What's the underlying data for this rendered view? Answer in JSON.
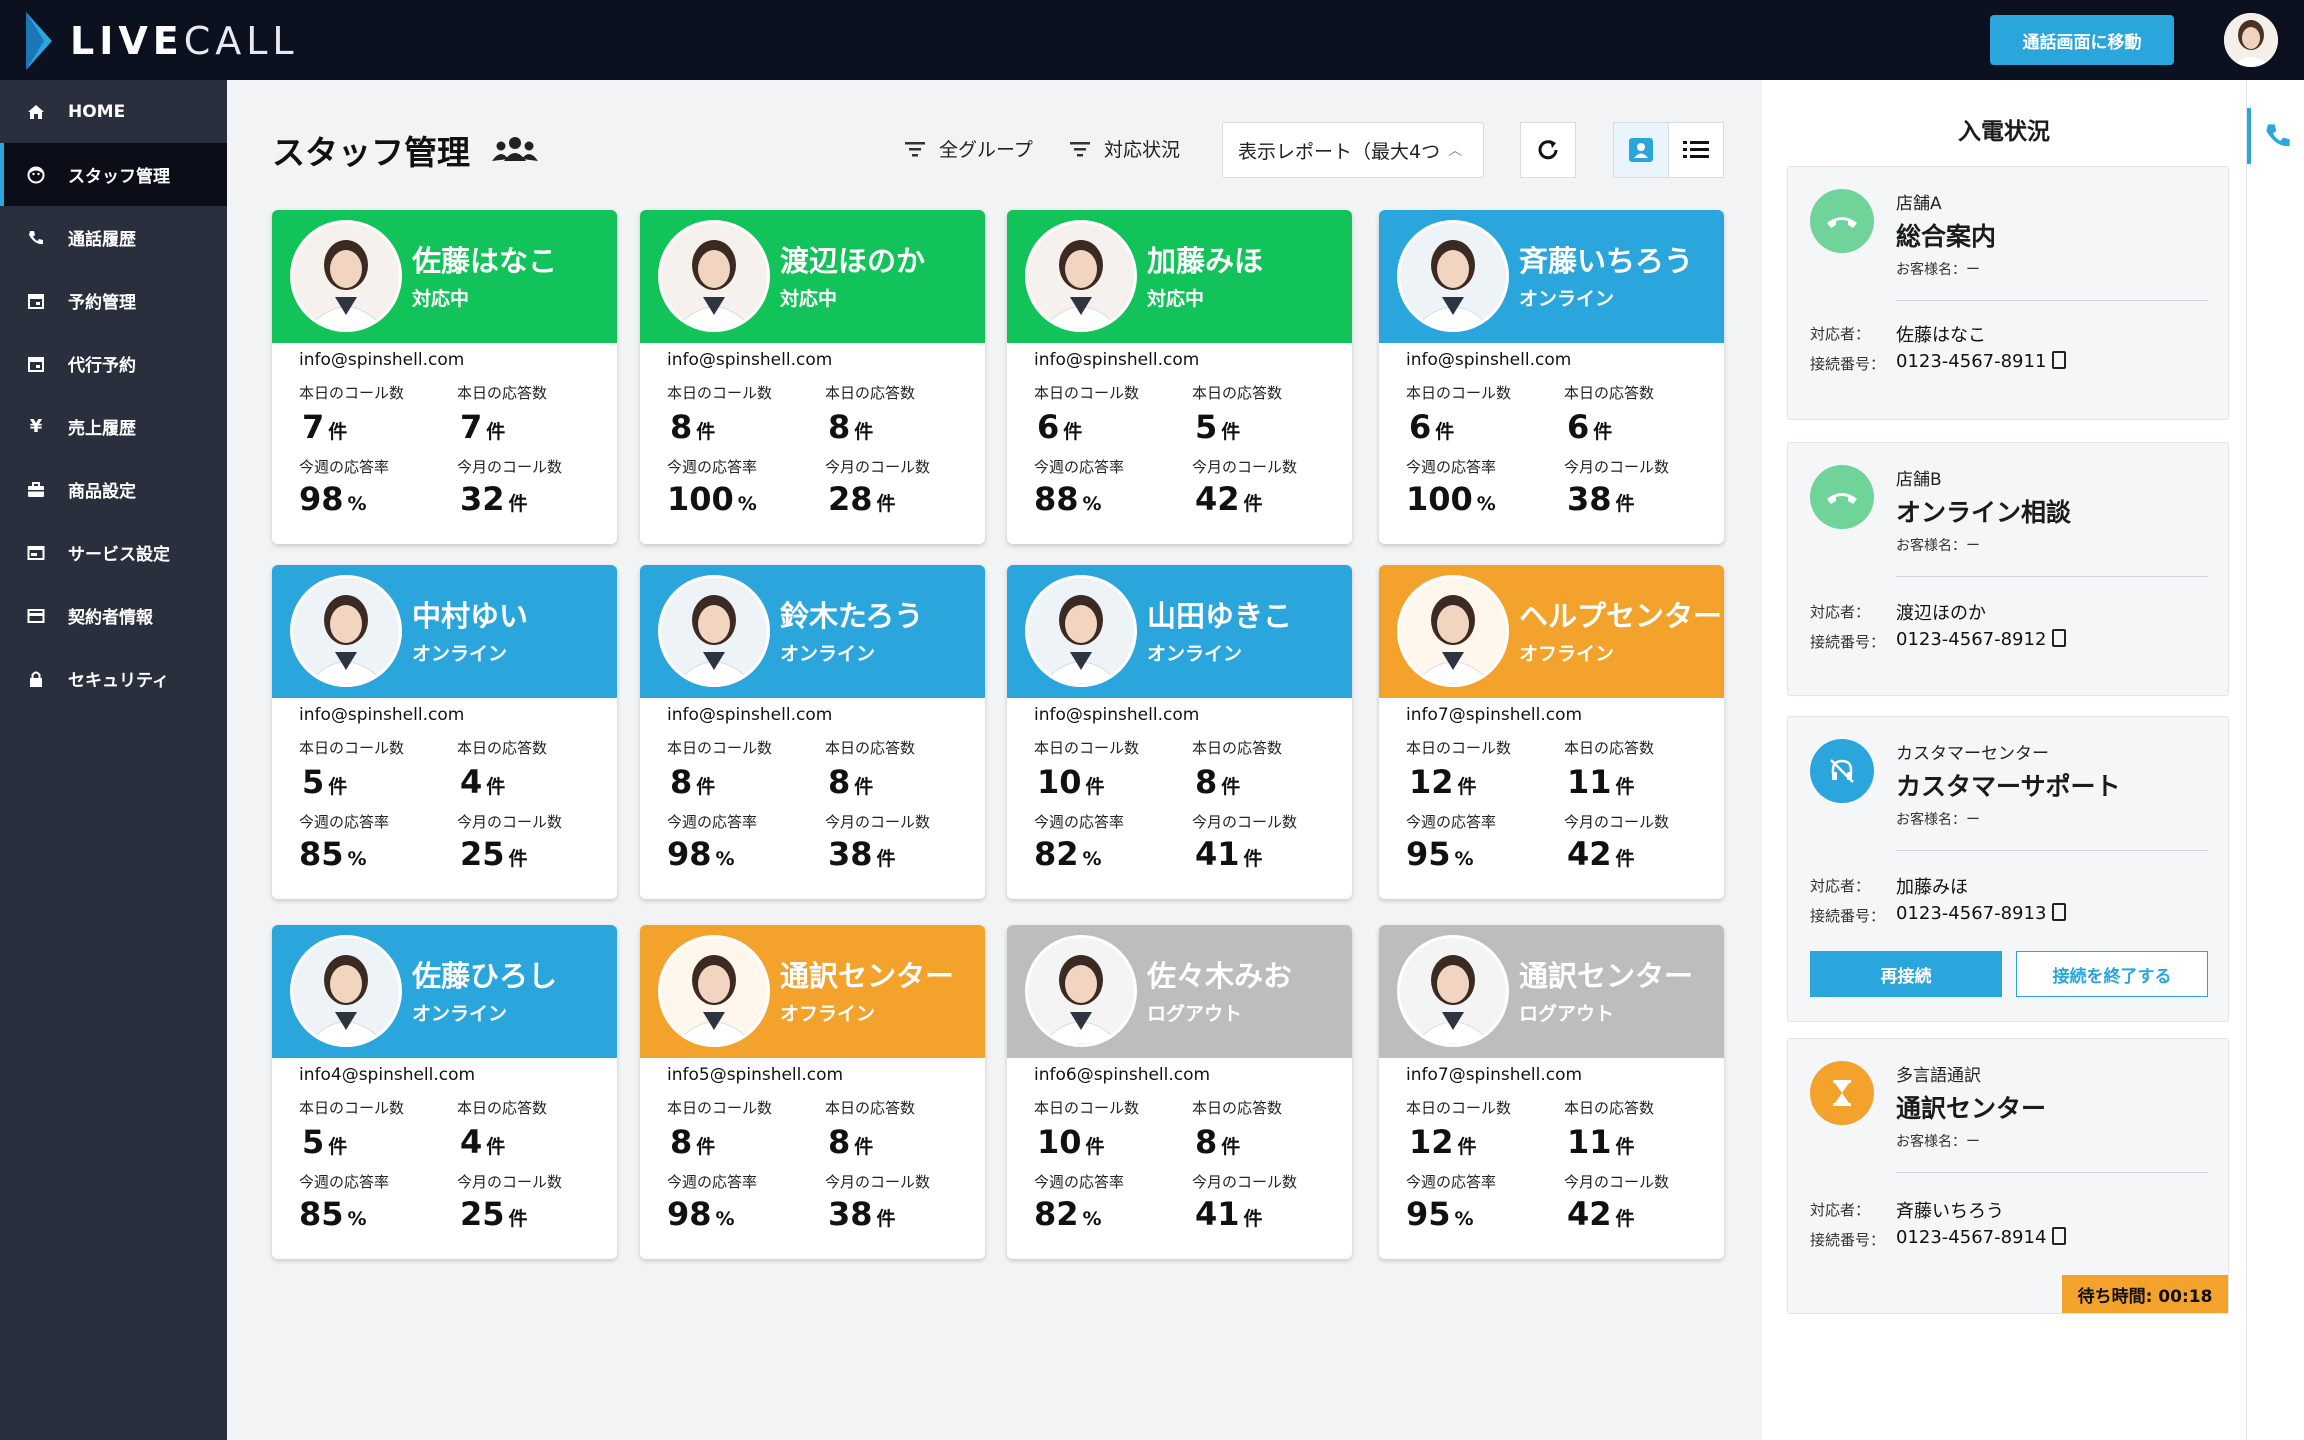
{
  "brand": {
    "name_bold": "LIVE",
    "name_light": "CALL"
  },
  "header": {
    "call_screen_button": "通話画面に移動"
  },
  "sidebar": {
    "items": [
      {
        "label": "HOME",
        "icon": "home-icon"
      },
      {
        "label": "スタッフ管理",
        "icon": "staff-face-icon",
        "active": true
      },
      {
        "label": "通話履歴",
        "icon": "phone-icon"
      },
      {
        "label": "予約管理",
        "icon": "calendar-icon"
      },
      {
        "label": "代行予約",
        "icon": "calendar-icon"
      },
      {
        "label": "売上履歴",
        "icon": "yen-icon"
      },
      {
        "label": "商品設定",
        "icon": "briefcase-icon"
      },
      {
        "label": "サービス設定",
        "icon": "window-icon"
      },
      {
        "label": "契約者情報",
        "icon": "card-icon"
      },
      {
        "label": "セキュリティ",
        "icon": "lock-icon"
      }
    ]
  },
  "main": {
    "title": "スタッフ管理",
    "filters": {
      "group": "全グループ",
      "status": "対応状況"
    },
    "report_select": "表示レポート（最大4つ",
    "labels": {
      "today_calls": "本日のコール数",
      "today_answers": "本日の応答数",
      "week_rate": "今週の応答率",
      "month_calls": "今月のコール数",
      "unit_count": "件",
      "unit_percent": "%"
    },
    "staff": [
      {
        "name": "佐藤はなこ",
        "status": "対応中",
        "color": "green",
        "email": "info@spinshell.com",
        "today_calls": "7",
        "today_answers": "7",
        "week_rate": "98",
        "month_calls": "32"
      },
      {
        "name": "渡辺ほのか",
        "status": "対応中",
        "color": "green",
        "email": "info@spinshell.com",
        "today_calls": "8",
        "today_answers": "8",
        "week_rate": "100",
        "month_calls": "28"
      },
      {
        "name": "加藤みほ",
        "status": "対応中",
        "color": "green",
        "email": "info@spinshell.com",
        "today_calls": "6",
        "today_answers": "5",
        "week_rate": "88",
        "month_calls": "42"
      },
      {
        "name": "斉藤いちろう",
        "status": "オンライン",
        "color": "blue",
        "email": "info@spinshell.com",
        "today_calls": "6",
        "today_answers": "6",
        "week_rate": "100",
        "month_calls": "38"
      },
      {
        "name": "中村ゆい",
        "status": "オンライン",
        "color": "blue",
        "email": "info@spinshell.com",
        "today_calls": "5",
        "today_answers": "4",
        "week_rate": "85",
        "month_calls": "25"
      },
      {
        "name": "鈴木たろう",
        "status": "オンライン",
        "color": "blue",
        "email": "info@spinshell.com",
        "today_calls": "8",
        "today_answers": "8",
        "week_rate": "98",
        "month_calls": "38"
      },
      {
        "name": "山田ゆきこ",
        "status": "オンライン",
        "color": "blue",
        "email": "info@spinshell.com",
        "today_calls": "10",
        "today_answers": "8",
        "week_rate": "82",
        "month_calls": "41"
      },
      {
        "name": "ヘルプセンター",
        "status": "オフライン",
        "color": "orange",
        "email": "info7@spinshell.com",
        "today_calls": "12",
        "today_answers": "11",
        "week_rate": "95",
        "month_calls": "42"
      },
      {
        "name": "佐藤ひろし",
        "status": "オンライン",
        "color": "blue",
        "email": "info4@spinshell.com",
        "today_calls": "5",
        "today_answers": "4",
        "week_rate": "85",
        "month_calls": "25"
      },
      {
        "name": "通訳センター",
        "status": "オフライン",
        "color": "orange",
        "email": "info5@spinshell.com",
        "today_calls": "8",
        "today_answers": "8",
        "week_rate": "98",
        "month_calls": "38"
      },
      {
        "name": "佐々木みお",
        "status": "ログアウト",
        "color": "gray",
        "email": "info6@spinshell.com",
        "today_calls": "10",
        "today_answers": "8",
        "week_rate": "82",
        "month_calls": "41"
      },
      {
        "name": "通訳センター",
        "status": "ログアウト",
        "color": "gray",
        "email": "info7@spinshell.com",
        "today_calls": "12",
        "today_answers": "11",
        "week_rate": "95",
        "month_calls": "42"
      }
    ]
  },
  "incoming": {
    "title": "入電状況",
    "labels": {
      "customer": "お客様名：ー",
      "agent": "対応者：",
      "conn": "接続番号：",
      "reconnect": "再接続",
      "end": "接続を終了する",
      "wait": "待ち時間: 00:18"
    },
    "calls": [
      {
        "shop": "店舗A",
        "title": "総合案内",
        "agent": "佐藤はなこ",
        "number": "0123-4567-8911",
        "icon_color": "#6fd39a"
      },
      {
        "shop": "店舗B",
        "title": "オンライン相談",
        "agent": "渡辺ほのか",
        "number": "0123-4567-8912",
        "icon_color": "#6fd39a"
      },
      {
        "shop": "カスタマーセンター",
        "title": "カスタマーサポート",
        "agent": "加藤みほ",
        "number": "0123-4567-8913",
        "icon_color": "#2ba6dd"
      },
      {
        "shop": "多言語通訳",
        "title": "通訳センター",
        "agent": "斉藤いちろう",
        "number": "0123-4567-8914",
        "icon_color": "#f3a22c"
      }
    ]
  },
  "colors": {
    "green": "#12c35a",
    "blue": "#2ba6dd",
    "orange": "#f3a22c",
    "gray": "#bdbdbd",
    "dark": "#0c1120"
  }
}
